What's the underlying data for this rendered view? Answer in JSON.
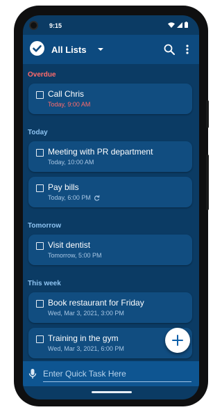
{
  "status_bar": {
    "time": "9:15",
    "icons": [
      "wifi-icon",
      "cellular-icon",
      "battery-icon"
    ]
  },
  "app_bar": {
    "title": "All Lists",
    "left_icon": "check-circle-icon",
    "actions": [
      "search-icon",
      "more-vert-icon"
    ]
  },
  "sections": [
    {
      "key": "overdue",
      "label": "Overdue",
      "color": "#ff6b6b",
      "tasks": [
        {
          "title": "Call Chris",
          "due": "Today, 9:00 AM",
          "overdue": true,
          "repeat": false,
          "checked": false
        }
      ]
    },
    {
      "key": "today",
      "label": "Today",
      "color": "#8ec4f2",
      "tasks": [
        {
          "title": "Meeting with PR department",
          "due": "Today, 10:00 AM",
          "overdue": false,
          "repeat": false,
          "checked": false
        },
        {
          "title": "Pay bills",
          "due": "Today, 6:00 PM",
          "overdue": false,
          "repeat": true,
          "checked": false
        }
      ]
    },
    {
      "key": "tomorrow",
      "label": "Tomorrow",
      "color": "#8ec4f2",
      "tasks": [
        {
          "title": "Visit dentist",
          "due": "Tomorrow, 5:00 PM",
          "overdue": false,
          "repeat": false,
          "checked": false
        }
      ]
    },
    {
      "key": "this_week",
      "label": "This week",
      "color": "#8ec4f2",
      "tasks": [
        {
          "title": "Book restaurant for Friday",
          "due": "Wed, Mar 3, 2021, 3:00 PM",
          "overdue": false,
          "repeat": false,
          "checked": false
        },
        {
          "title": "Training in the gym",
          "due": "Wed, Mar 3, 2021, 6:00 PM",
          "overdue": false,
          "repeat": false,
          "checked": false
        }
      ]
    }
  ],
  "fab": {
    "icon": "plus-icon"
  },
  "quick_task": {
    "placeholder": "Enter Quick Task Here",
    "icon": "microphone-icon"
  },
  "colors": {
    "background": "#0b3b64",
    "app_bar": "#0d4a7f",
    "card": "#114d80",
    "section_header": "#8ec4f2",
    "overdue": "#ff6b6b",
    "quick_bar": "#0e5591",
    "accent": "#0d4a7f"
  }
}
